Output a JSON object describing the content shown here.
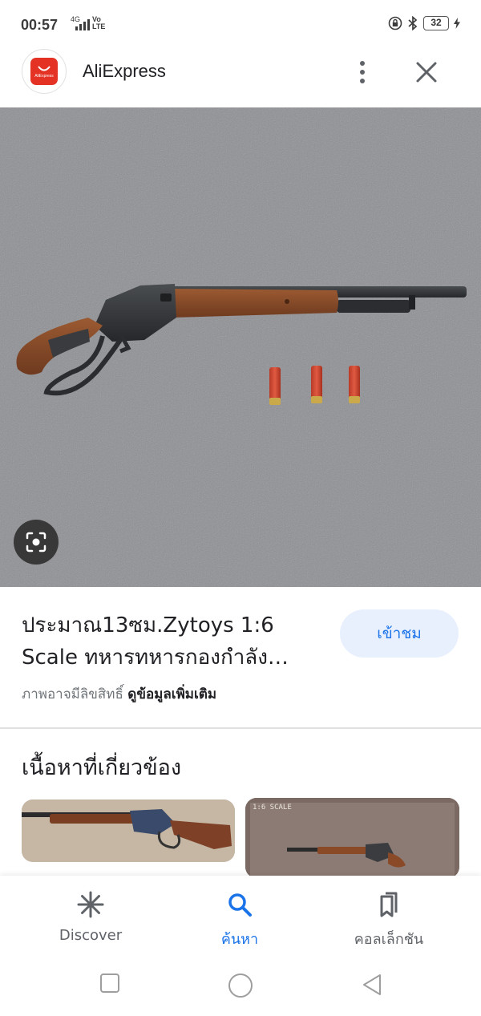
{
  "status_bar": {
    "time": "00:57",
    "network": "4G",
    "volte": "Vo\nLTE",
    "battery": "32"
  },
  "app_header": {
    "logo_text": "AliExpress",
    "title": "AliExpress"
  },
  "product": {
    "title": "ประมาณ13ซม.Zytoys 1:6 Scale ทหารทหารกองกำลัง…",
    "visit_label": "เข้าชม",
    "copyright_text": "ภาพอาจมีลิขสิทธิ์",
    "more_info_label": "ดูข้อมูลเพิ่มเติม"
  },
  "related": {
    "heading": "เนื้อหาที่เกี่ยวข้อง",
    "thumb_2_tag": "1:6 SCALE"
  },
  "bottom_nav": {
    "items": [
      {
        "label": "Discover",
        "icon": "asterisk-icon"
      },
      {
        "label": "ค้นหา",
        "icon": "search-icon"
      },
      {
        "label": "คอลเล็กชัน",
        "icon": "bookmarks-icon"
      }
    ]
  },
  "colors": {
    "accent": "#1a73e8",
    "visit_button_bg": "#e8f0fe",
    "brand_logo": "#e43225"
  }
}
